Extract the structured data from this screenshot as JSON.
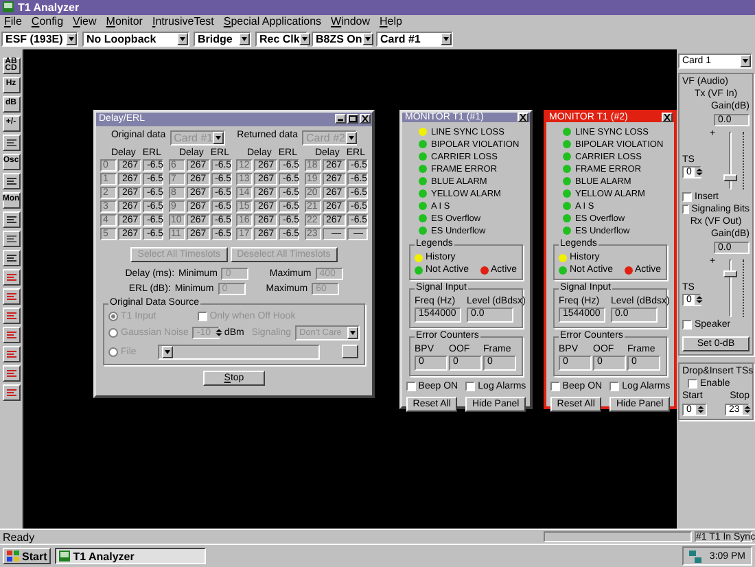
{
  "window": {
    "title": "T1 Analyzer"
  },
  "menu": [
    "File",
    "Config",
    "View",
    "Monitor",
    "IntrusiveTest",
    "Special Applications",
    "Window",
    "Help"
  ],
  "toolbar": [
    {
      "value": "ESF (193E)"
    },
    {
      "value": "No Loopback"
    },
    {
      "value": "Bridge"
    },
    {
      "value": "Rec Clk"
    },
    {
      "value": "B8ZS On"
    },
    {
      "value": "Card #1"
    }
  ],
  "tool_buttons": [
    {
      "kind": "text",
      "label": "AB CD",
      "color": "#000000"
    },
    {
      "kind": "text",
      "label": "Hz",
      "color": "#000000"
    },
    {
      "kind": "text",
      "label": "dB",
      "color": "#000000"
    },
    {
      "kind": "text",
      "label": "+/-",
      "color": "#000000"
    },
    {
      "kind": "icon",
      "color": "#505050"
    },
    {
      "kind": "text",
      "label": "Osc",
      "color": "#000000"
    },
    {
      "kind": "icon",
      "color": "#303030"
    },
    {
      "kind": "text",
      "label": "Mon",
      "color": "#000000"
    },
    {
      "kind": "icon",
      "color": "#303030"
    },
    {
      "kind": "icon",
      "color": "#606060"
    },
    {
      "kind": "icon",
      "color": "#303030"
    },
    {
      "kind": "icon",
      "color": "#cc2020"
    },
    {
      "kind": "icon",
      "color": "#cc2020"
    },
    {
      "kind": "icon",
      "color": "#cc2020"
    },
    {
      "kind": "icon",
      "color": "#cc2020"
    },
    {
      "kind": "icon",
      "color": "#cc2020"
    },
    {
      "kind": "icon",
      "color": "#cc2020"
    },
    {
      "kind": "icon",
      "color": "#cc2020"
    }
  ],
  "delay_erl": {
    "title": "Delay/ERL",
    "original_label": "Original data",
    "original_value": "Card #1",
    "returned_label": "Returned data",
    "returned_value": "Card #2",
    "groups": [
      {
        "headers": [
          "Delay",
          "ERL"
        ],
        "rows": [
          {
            "index": "0",
            "delay": "267",
            "erl": "-6.5"
          },
          {
            "index": "1",
            "delay": "267",
            "erl": "-6.5"
          },
          {
            "index": "2",
            "delay": "267",
            "erl": "-6.5"
          },
          {
            "index": "3",
            "delay": "267",
            "erl": "-6.5"
          },
          {
            "index": "4",
            "delay": "267",
            "erl": "-6.5"
          },
          {
            "index": "5",
            "delay": "267",
            "erl": "-6.5"
          }
        ]
      },
      {
        "headers": [
          "Delay",
          "ERL"
        ],
        "rows": [
          {
            "index": "6",
            "delay": "267",
            "erl": "-6.5"
          },
          {
            "index": "7",
            "delay": "267",
            "erl": "-6.5"
          },
          {
            "index": "8",
            "delay": "267",
            "erl": "-6.5"
          },
          {
            "index": "9",
            "delay": "267",
            "erl": "-6.5"
          },
          {
            "index": "10",
            "delay": "267",
            "erl": "-6.5"
          },
          {
            "index": "11",
            "delay": "267",
            "erl": "-6.5"
          }
        ]
      },
      {
        "headers": [
          "Delay",
          "ERL"
        ],
        "rows": [
          {
            "index": "12",
            "delay": "267",
            "erl": "-6.5"
          },
          {
            "index": "13",
            "delay": "267",
            "erl": "-6.5"
          },
          {
            "index": "14",
            "delay": "267",
            "erl": "-6.5"
          },
          {
            "index": "15",
            "delay": "267",
            "erl": "-6.5"
          },
          {
            "index": "16",
            "delay": "267",
            "erl": "-6.5"
          },
          {
            "index": "17",
            "delay": "267",
            "erl": "-6.5"
          }
        ]
      },
      {
        "headers": [
          "Delay",
          "ERL"
        ],
        "rows": [
          {
            "index": "18",
            "delay": "267",
            "erl": "-6.5"
          },
          {
            "index": "19",
            "delay": "267",
            "erl": "-6.5"
          },
          {
            "index": "20",
            "delay": "267",
            "erl": "-6.5"
          },
          {
            "index": "21",
            "delay": "267",
            "erl": "-6.5"
          },
          {
            "index": "22",
            "delay": "267",
            "erl": "-6.5"
          },
          {
            "index": "23",
            "delay": "—",
            "erl": "—"
          }
        ]
      }
    ],
    "select_all": "Select All Timeslots",
    "deselect_all": "Deselect All Timeslots",
    "limits": [
      {
        "label": "Delay (ms):",
        "minimum": "Minimum",
        "min": "0",
        "maximum": "Maximum",
        "max": "400"
      },
      {
        "label": "ERL (dB):",
        "minimum": "Minimum",
        "min": "0",
        "maximum": "Maximum",
        "max": "60"
      }
    ],
    "source": {
      "title": "Original Data Source",
      "t1": {
        "label": "T1 Input",
        "selected": true
      },
      "offhook": {
        "label": "Only when Off Hook",
        "checked": false
      },
      "noise": {
        "label": "Gaussian Noise",
        "selected": false
      },
      "noise_value": "-10",
      "dbm": "dBm",
      "signaling_label": "Signaling",
      "signaling_value": "Don't Care",
      "file": {
        "label": "File",
        "selected": false
      }
    },
    "stop": "Stop"
  },
  "monitors": [
    {
      "title": "MONITOR T1 (#1)",
      "active": false,
      "alarms": [
        {
          "label": "LINE SYNC LOSS",
          "color": "#f0f000"
        },
        {
          "label": "BIPOLAR VIOLATION",
          "color": "#20c020"
        },
        {
          "label": "CARRIER LOSS",
          "color": "#20c020"
        },
        {
          "label": "FRAME ERROR",
          "color": "#20c020"
        },
        {
          "label": "BLUE ALARM",
          "color": "#20c020"
        },
        {
          "label": "YELLOW ALARM",
          "color": "#20c020"
        },
        {
          "label": "A I S",
          "color": "#20c020"
        },
        {
          "label": "ES Overflow",
          "color": "#20c020"
        },
        {
          "label": "ES Underflow",
          "color": "#20c020"
        }
      ],
      "legend_title": "Legends",
      "legend": [
        {
          "label": "History",
          "color": "#f0f000"
        },
        {
          "label": "Not Active",
          "color": "#20c020"
        },
        {
          "label": "Active",
          "color": "#e02010"
        }
      ],
      "signal_title": "Signal Input",
      "freq_label": "Freq (Hz)",
      "freq": "1544000",
      "level_label": "Level (dBdsx)",
      "level": "0.0",
      "counters_title": "Error Counters",
      "counters": [
        {
          "label": "BPV",
          "value": "0"
        },
        {
          "label": "OOF",
          "value": "0"
        },
        {
          "label": "Frame",
          "value": "0"
        }
      ],
      "checks": [
        {
          "label": "Beep ON",
          "checked": false
        },
        {
          "label": "Log Alarms",
          "checked": false
        }
      ],
      "buttons": [
        "Reset All",
        "Hide Panel"
      ]
    },
    {
      "title": "MONITOR T1 (#2)",
      "active": true,
      "alarms": [
        {
          "label": "LINE SYNC LOSS",
          "color": "#20c020"
        },
        {
          "label": "BIPOLAR VIOLATION",
          "color": "#20c020"
        },
        {
          "label": "CARRIER LOSS",
          "color": "#20c020"
        },
        {
          "label": "FRAME ERROR",
          "color": "#20c020"
        },
        {
          "label": "BLUE ALARM",
          "color": "#20c020"
        },
        {
          "label": "YELLOW ALARM",
          "color": "#20c020"
        },
        {
          "label": "A I S",
          "color": "#20c020"
        },
        {
          "label": "ES Overflow",
          "color": "#20c020"
        },
        {
          "label": "ES Underflow",
          "color": "#20c020"
        }
      ],
      "legend_title": "Legends",
      "legend": [
        {
          "label": "History",
          "color": "#f0f000"
        },
        {
          "label": "Not Active",
          "color": "#20c020"
        },
        {
          "label": "Active",
          "color": "#e02010"
        }
      ],
      "signal_title": "Signal Input",
      "freq_label": "Freq (Hz)",
      "freq": "1544000",
      "level_label": "Level (dBdsx)",
      "level": "0.0",
      "counters_title": "Error Counters",
      "counters": [
        {
          "label": "BPV",
          "value": "0"
        },
        {
          "label": "OOF",
          "value": "0"
        },
        {
          "label": "Frame",
          "value": "0"
        }
      ],
      "checks": [
        {
          "label": "Beep ON",
          "checked": false
        },
        {
          "label": "Log Alarms",
          "checked": false
        }
      ],
      "buttons": [
        "Reset All",
        "Hide Panel"
      ]
    }
  ],
  "side_panel": {
    "card": "Card 1",
    "vf_title": "VF (Audio)",
    "tx": {
      "title": "Tx (VF In)",
      "gain_label": "Gain(dB)",
      "gain": "0.0",
      "plus": "+",
      "ts_label": "TS",
      "ts": "0",
      "level": 0.2
    },
    "tx_checks": [
      {
        "label": "Insert",
        "checked": false
      },
      {
        "label": "Signaling Bits",
        "checked": false
      }
    ],
    "rx": {
      "title": "Rx (VF Out)",
      "gain_label": "Gain(dB)",
      "gain": "0.0",
      "plus": "+",
      "ts_label": "TS",
      "ts": "0",
      "level": 0.75
    },
    "speaker": {
      "label": "Speaker",
      "checked": false
    },
    "set0": "Set 0-dB",
    "drop": {
      "title": "Drop&Insert TSs",
      "enable": {
        "label": "Enable",
        "checked": false
      },
      "start_label": "Start",
      "start": "0",
      "stop_label": "Stop",
      "stop": "23"
    }
  },
  "status_bar": {
    "text": "Ready",
    "sync": "#1 T1 In Sync"
  },
  "taskbar": {
    "start": "Start",
    "task": "T1 Analyzer",
    "time": "3:09 PM"
  }
}
